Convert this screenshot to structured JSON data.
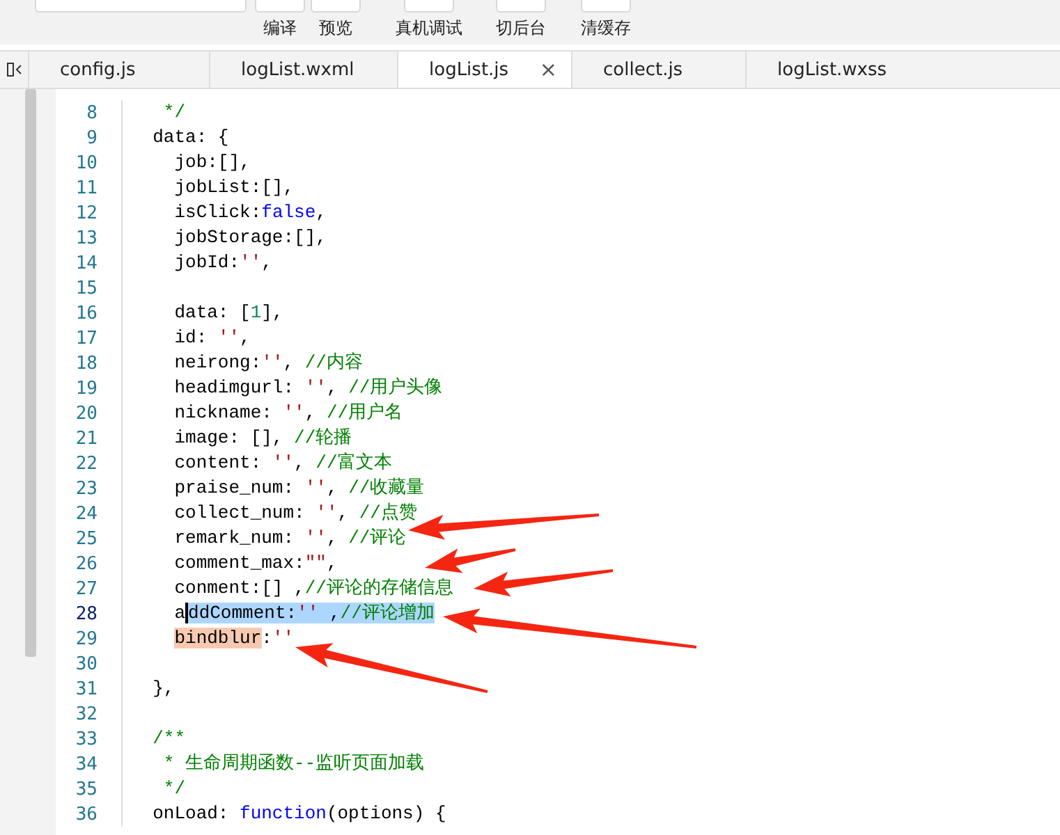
{
  "toolbar": {
    "buttons": [
      {
        "label": "编译"
      },
      {
        "label": "预览"
      },
      {
        "label": "真机调试"
      },
      {
        "label": "切后台"
      },
      {
        "label": "清缓存"
      }
    ]
  },
  "tabs": [
    {
      "label": "config.js",
      "selected": false
    },
    {
      "label": "logList.wxml",
      "selected": false
    },
    {
      "label": "logList.js",
      "selected": true,
      "close": "×"
    },
    {
      "label": "collect.js",
      "selected": false
    },
    {
      "label": "logList.wxss",
      "selected": false
    }
  ],
  "editor": {
    "lines": [
      {
        "number": "8",
        "current": false,
        "tokens": [
          {
            "kind": "comment",
            "text": "   */"
          }
        ]
      },
      {
        "number": "9",
        "current": false,
        "tokens": [
          {
            "kind": "plain",
            "text": "  data: {"
          }
        ]
      },
      {
        "number": "10",
        "current": false,
        "tokens": [
          {
            "kind": "plain",
            "text": "    job:[],"
          }
        ]
      },
      {
        "number": "11",
        "current": false,
        "tokens": [
          {
            "kind": "plain",
            "text": "    jobList:[],"
          }
        ]
      },
      {
        "number": "12",
        "current": false,
        "tokens": [
          {
            "kind": "plain",
            "text": "    isClick:"
          },
          {
            "kind": "keyword",
            "text": "false"
          },
          {
            "kind": "plain",
            "text": ","
          }
        ]
      },
      {
        "number": "13",
        "current": false,
        "tokens": [
          {
            "kind": "plain",
            "text": "    jobStorage:[],"
          }
        ]
      },
      {
        "number": "14",
        "current": false,
        "tokens": [
          {
            "kind": "plain",
            "text": "    jobId:"
          },
          {
            "kind": "string",
            "text": "''"
          },
          {
            "kind": "plain",
            "text": ","
          }
        ]
      },
      {
        "number": "15",
        "current": false
      },
      {
        "number": "16",
        "current": false,
        "tokens": [
          {
            "kind": "plain",
            "text": "    data: ["
          },
          {
            "kind": "number",
            "text": "1"
          },
          {
            "kind": "plain",
            "text": "],"
          }
        ]
      },
      {
        "number": "17",
        "current": false,
        "tokens": [
          {
            "kind": "plain",
            "text": "    id: "
          },
          {
            "kind": "string",
            "text": "''"
          },
          {
            "kind": "plain",
            "text": ","
          }
        ]
      },
      {
        "number": "18",
        "current": false,
        "tokens": [
          {
            "kind": "plain",
            "text": "    neirong:"
          },
          {
            "kind": "string",
            "text": "''"
          },
          {
            "kind": "plain",
            "text": ", "
          },
          {
            "kind": "comment",
            "text": "//内容"
          }
        ]
      },
      {
        "number": "19",
        "current": false,
        "tokens": [
          {
            "kind": "plain",
            "text": "    headimgurl: "
          },
          {
            "kind": "string",
            "text": "''"
          },
          {
            "kind": "plain",
            "text": ", "
          },
          {
            "kind": "comment",
            "text": "//用户头像"
          }
        ]
      },
      {
        "number": "20",
        "current": false,
        "tokens": [
          {
            "kind": "plain",
            "text": "    nickname: "
          },
          {
            "kind": "string",
            "text": "''"
          },
          {
            "kind": "plain",
            "text": ", "
          },
          {
            "kind": "comment",
            "text": "//用户名"
          }
        ]
      },
      {
        "number": "21",
        "current": false,
        "tokens": [
          {
            "kind": "plain",
            "text": "    image: [], "
          },
          {
            "kind": "comment",
            "text": "//轮播"
          }
        ]
      },
      {
        "number": "22",
        "current": false,
        "tokens": [
          {
            "kind": "plain",
            "text": "    content: "
          },
          {
            "kind": "string",
            "text": "''"
          },
          {
            "kind": "plain",
            "text": ", "
          },
          {
            "kind": "comment",
            "text": "//富文本"
          }
        ]
      },
      {
        "number": "23",
        "current": false,
        "tokens": [
          {
            "kind": "plain",
            "text": "    praise_num: "
          },
          {
            "kind": "string",
            "text": "''"
          },
          {
            "kind": "plain",
            "text": ", "
          },
          {
            "kind": "comment",
            "text": "//收藏量"
          }
        ]
      },
      {
        "number": "24",
        "current": false,
        "tokens": [
          {
            "kind": "plain",
            "text": "    collect_num: "
          },
          {
            "kind": "string",
            "text": "''"
          },
          {
            "kind": "plain",
            "text": ", "
          },
          {
            "kind": "comment",
            "text": "//点赞"
          }
        ]
      },
      {
        "number": "25",
        "current": false,
        "tokens": [
          {
            "kind": "plain",
            "text": "    remark_num: "
          },
          {
            "kind": "string",
            "text": "''"
          },
          {
            "kind": "plain",
            "text": ", "
          },
          {
            "kind": "comment",
            "text": "//评论"
          }
        ]
      },
      {
        "number": "26",
        "current": false,
        "tokens": [
          {
            "kind": "plain",
            "text": "    comment_max:"
          },
          {
            "kind": "string",
            "text": "\"\""
          },
          {
            "kind": "plain",
            "text": ","
          }
        ]
      },
      {
        "number": "27",
        "current": false,
        "tokens": [
          {
            "kind": "plain",
            "text": "    conment:[] ,"
          },
          {
            "kind": "comment",
            "text": "//评论的存储信息"
          }
        ]
      },
      {
        "number": "28",
        "current": true,
        "tokens": [
          {
            "kind": "plain",
            "text": "    a"
          },
          {
            "kind": "plain",
            "text": "ddComment:",
            "selected": true,
            "caret": true
          },
          {
            "kind": "string",
            "text": "''",
            "selected": true
          },
          {
            "kind": "plain",
            "text": " ,",
            "selected": true
          },
          {
            "kind": "comment",
            "text": "//评论增加",
            "selected": true
          }
        ]
      },
      {
        "number": "29",
        "current": false,
        "tokens": [
          {
            "kind": "plain",
            "text": "    bindblur",
            "match": true
          },
          {
            "kind": "plain",
            "text": ":"
          },
          {
            "kind": "string",
            "text": "''"
          }
        ]
      },
      {
        "number": "30",
        "current": false
      },
      {
        "number": "31",
        "current": false,
        "tokens": [
          {
            "kind": "plain",
            "text": "  },"
          }
        ]
      },
      {
        "number": "32",
        "current": false
      },
      {
        "number": "33",
        "current": false,
        "tokens": [
          {
            "kind": "comment",
            "text": "  /**"
          }
        ]
      },
      {
        "number": "34",
        "current": false,
        "tokens": [
          {
            "kind": "comment",
            "text": "   * 生命周期函数--监听页面加载"
          }
        ]
      },
      {
        "number": "35",
        "current": false,
        "tokens": [
          {
            "kind": "comment",
            "text": "   */"
          }
        ]
      },
      {
        "number": "36",
        "current": false,
        "tokens": [
          {
            "kind": "plain",
            "text": "  onLoad: "
          },
          {
            "kind": "keyword",
            "text": "function"
          },
          {
            "kind": "plain",
            "text": "(options) {"
          }
        ]
      }
    ]
  }
}
